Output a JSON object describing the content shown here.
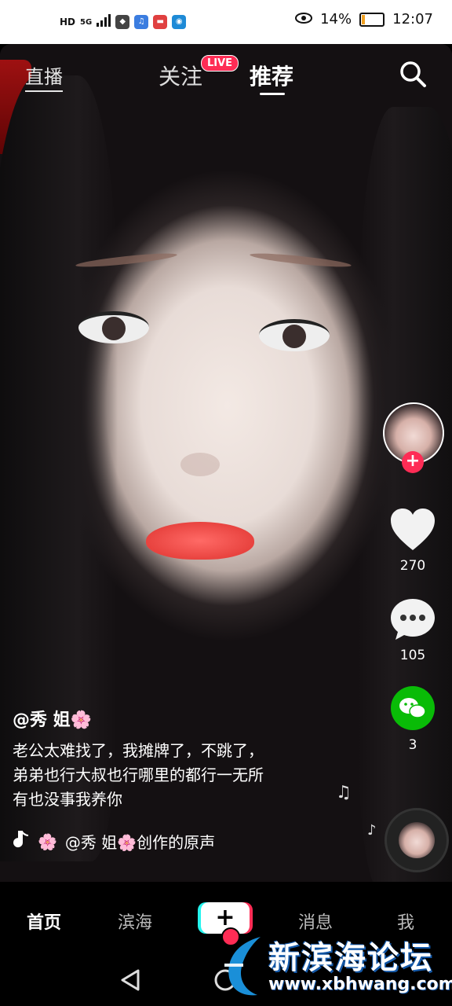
{
  "status_bar": {
    "net_label": "HD",
    "signal_label": "5G",
    "battery_percent_text": "14%",
    "battery_level": 0.14,
    "time": "12:07"
  },
  "top_nav": {
    "live_label": "直播",
    "follow_label": "关注",
    "live_badge": "LIVE",
    "recommend_label": "推荐",
    "search_icon": "search-icon"
  },
  "video": {
    "author": "@秀 姐🌸",
    "description_lines": [
      "老公太难找了，我摊牌了，不跳了，",
      "弟弟也行大叔也行哪里的都行一无所",
      "有也没事我养你"
    ],
    "music_prefix": "🌸",
    "music": "@秀 姐🌸创作的原声"
  },
  "right_rail": {
    "likes": "270",
    "comments": "105",
    "shares": "3",
    "follow_icon": "plus-icon"
  },
  "bottom_nav": {
    "home": "首页",
    "local": "滨海",
    "create": "+",
    "messages": "消息",
    "me": "我"
  },
  "watermark": {
    "title": "新滨海论坛",
    "url": "www.xbhwang.com"
  },
  "colors": {
    "accent": "#fe2c55",
    "cyan": "#25f4ee",
    "wechat": "#09bb07"
  }
}
